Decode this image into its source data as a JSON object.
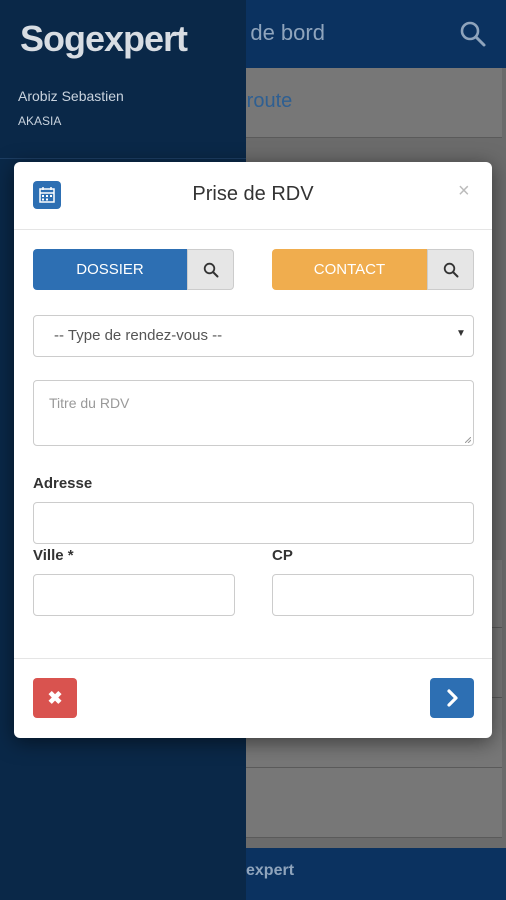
{
  "app": {
    "header_title": "u de bord",
    "row_title": "e route",
    "footer_text": "expert"
  },
  "sidebar": {
    "logo": "Sogexpert",
    "user_name": "Arobiz Sebastien",
    "user_company": "AKASIA"
  },
  "modal": {
    "title": "Prise de RDV",
    "close": "×",
    "dossier_label": "DOSSIER",
    "contact_label": "CONTACT",
    "type_select": "-- Type de rendez-vous --",
    "title_placeholder": "Titre du RDV",
    "address_label": "Adresse",
    "address_value": "",
    "ville_label": "Ville *",
    "ville_value": "",
    "cp_label": "CP",
    "cp_value": "",
    "cancel_symbol": "✖"
  },
  "colors": {
    "primary": "#2d6fb3",
    "warning": "#f0ad4e",
    "danger": "#d9534f",
    "navy": "#0b3260"
  }
}
